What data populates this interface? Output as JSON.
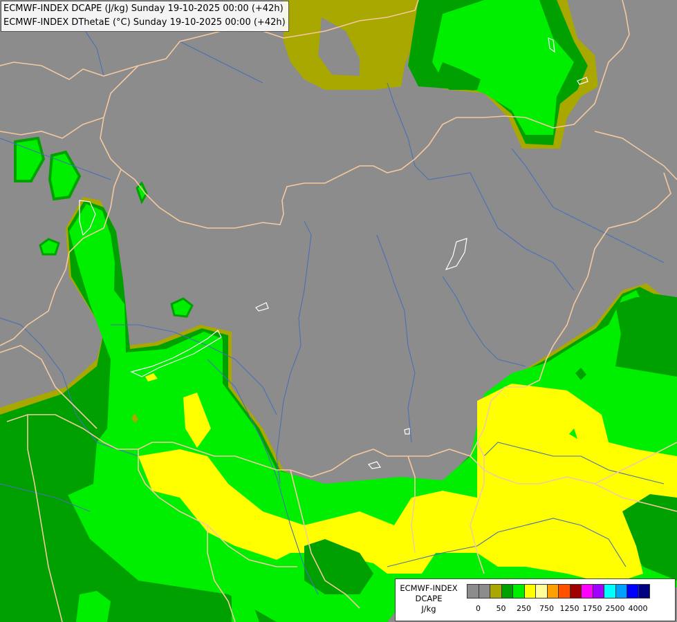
{
  "title": {
    "line1": "ECMWF-INDEX DCAPE (J/kg) Sunday 19-10-2025 00:00 (+42h)",
    "line2": "ECMWF-INDEX DThetaE (°C) Sunday 19-10-2025 00:00 (+42h)"
  },
  "colors": {
    "background": "#8c8c8c",
    "border": "#f5c9a0",
    "river": "#4a6fb5",
    "lake": "#ffffff",
    "c50": "#a8a800",
    "c100": "#00a000",
    "c250": "#00ee00",
    "c500": "#ffff00",
    "c750": "#ffff99"
  },
  "legend": {
    "label_lines": [
      "ECMWF-INDEX",
      "DCAPE",
      "J/kg"
    ],
    "swatch_colors": [
      "#8c8c8c",
      "#8c8c8c",
      "#a8a800",
      "#00a000",
      "#00ee00",
      "#ffff00",
      "#ffff99",
      "#ffa000",
      "#ff5000",
      "#a00000",
      "#ff00ff",
      "#a000ff",
      "#00ffff",
      "#00a0ff",
      "#0000ff",
      "#000080"
    ],
    "tick_labels": [
      "0",
      "50",
      "250",
      "750",
      "1250",
      "1750",
      "2500",
      "4000"
    ]
  }
}
